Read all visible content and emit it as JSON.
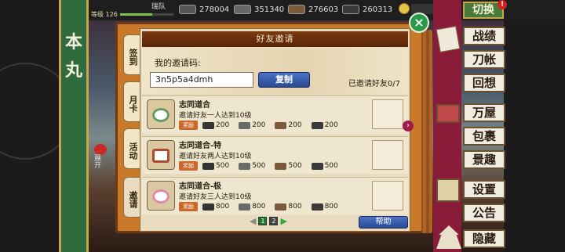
{
  "player": {
    "level_label": "等级",
    "level": "126",
    "level_progress": 0.6,
    "team_label": "瑞队"
  },
  "resources": [
    {
      "icon": "charcoal-icon",
      "value": "278004"
    },
    {
      "icon": "steel-icon",
      "value": "351340"
    },
    {
      "icon": "cooling-material-icon",
      "value": "276603"
    },
    {
      "icon": "whetstone-icon",
      "value": "260313"
    }
  ],
  "coins": {
    "icon": "coin-icon",
    "value": "0",
    "add": "+"
  },
  "switch_button": {
    "label": "切换",
    "badge": "!"
  },
  "banner": {
    "chars": [
      "本",
      "丸"
    ]
  },
  "mail": {
    "label": "展开"
  },
  "right_menu": [
    "战绩",
    "刀帐",
    "回想",
    "万屋",
    "包裹",
    "景趣",
    "设置",
    "公告",
    "隐藏"
  ],
  "dialog": {
    "title": "好友邀请",
    "tabs": [
      "签到",
      "月卡",
      "活动",
      "邀请"
    ],
    "active_tab": 3,
    "invite_label": "我的邀请码:",
    "invite_code": "3n5p5a4dmh",
    "copy_button": "复制",
    "invited_status": "已邀请好友0/7",
    "reward_label": "奖励",
    "tasks": [
      {
        "name": "志同道合",
        "desc": "邀请好友一人达到10级",
        "rewards": [
          "200",
          "200",
          "200",
          "200"
        ]
      },
      {
        "name": "志同道合-特",
        "desc": "邀请好友两人达到10级",
        "rewards": [
          "500",
          "500",
          "500",
          "500"
        ]
      },
      {
        "name": "志同道合-极",
        "desc": "邀请好友三人达到10级",
        "rewards": [
          "800",
          "800",
          "800",
          "800"
        ]
      }
    ],
    "pages": [
      "1",
      "2"
    ],
    "current_page": 2,
    "help_button": "帮助",
    "close": "×"
  },
  "colors": {
    "accent_green": "#2a9a4a",
    "button_blue": "#2a4a90",
    "reward_orange": "#c9682a"
  }
}
